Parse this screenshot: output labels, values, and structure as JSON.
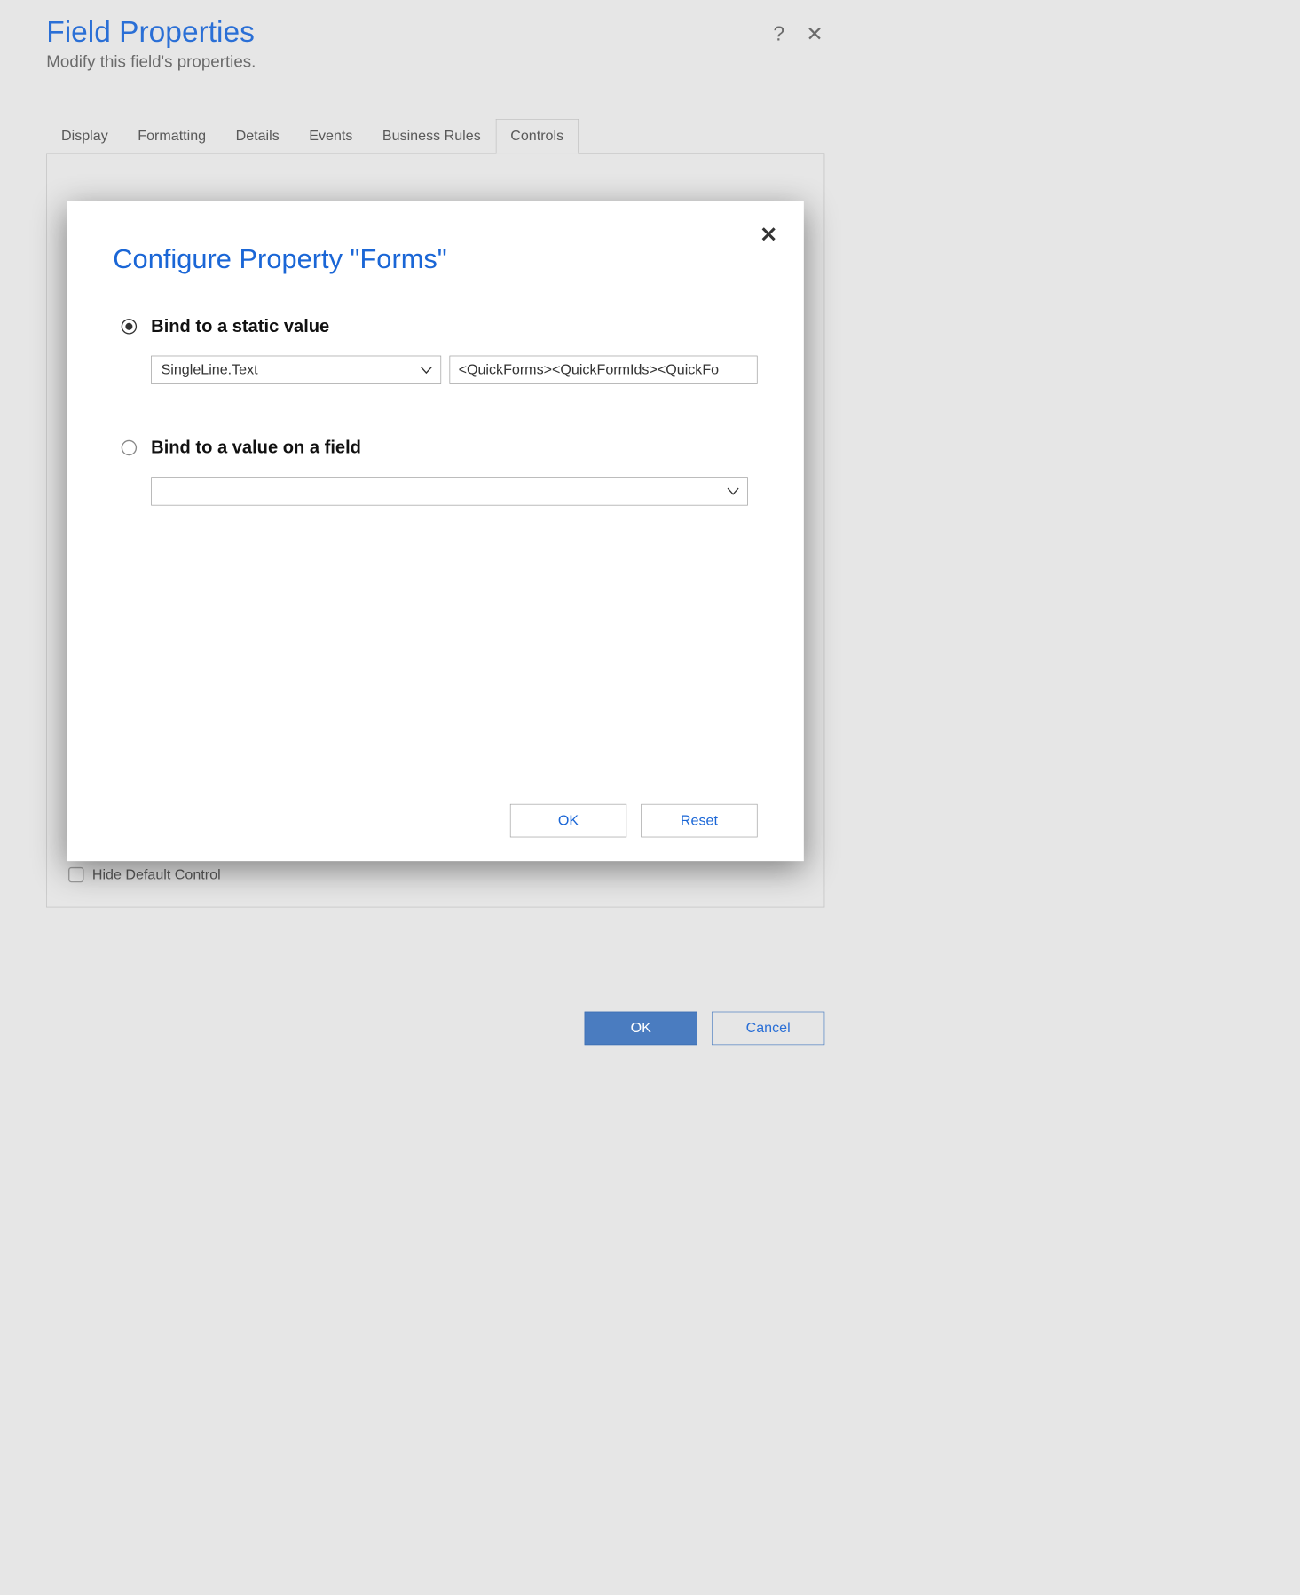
{
  "header": {
    "title": "Field Properties",
    "subtitle": "Modify this field's properties.",
    "help_label": "?",
    "close_label": "✕"
  },
  "tabs": [
    {
      "label": "Display",
      "selected": false
    },
    {
      "label": "Formatting",
      "selected": false
    },
    {
      "label": "Details",
      "selected": false
    },
    {
      "label": "Events",
      "selected": false
    },
    {
      "label": "Business Rules",
      "selected": false
    },
    {
      "label": "Controls",
      "selected": true
    }
  ],
  "controls_panel": {
    "hide_default_control_label": "Hide Default Control",
    "hide_default_control_checked": false
  },
  "footer": {
    "ok_label": "OK",
    "cancel_label": "Cancel"
  },
  "modal": {
    "title": "Configure Property \"Forms\"",
    "close_label": "✕",
    "option_static": {
      "label": "Bind to a static value",
      "selected": true,
      "type_select_value": "SingleLine.Text",
      "value_input": "<QuickForms><QuickFormIds><QuickFo"
    },
    "option_field": {
      "label": "Bind to a value on a field",
      "selected": false,
      "field_select_value": ""
    },
    "ok_label": "OK",
    "reset_label": "Reset"
  }
}
